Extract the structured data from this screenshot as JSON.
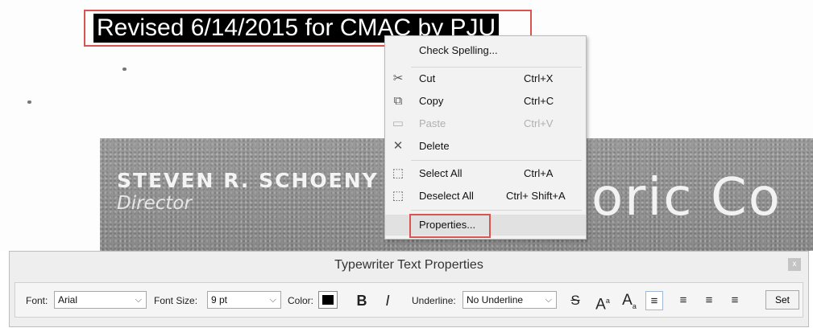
{
  "document": {
    "header_text": "Revised 6/14/2015 for CMAC by PJU",
    "scan": {
      "name": "STEVEN R. SCHOENY",
      "title": "Director",
      "big_text_1": "oric",
      "big_text_2": "Co"
    }
  },
  "context_menu": {
    "items": [
      {
        "label": "Check Spelling...",
        "shortcut": "",
        "icon": "",
        "disabled": false
      },
      {
        "label": "Cut",
        "shortcut": "Ctrl+X",
        "icon": "scissors-icon",
        "disabled": false
      },
      {
        "label": "Copy",
        "shortcut": "Ctrl+C",
        "icon": "copy-icon",
        "disabled": false
      },
      {
        "label": "Paste",
        "shortcut": "Ctrl+V",
        "icon": "paste-icon",
        "disabled": true
      },
      {
        "label": "Delete",
        "shortcut": "",
        "icon": "delete-icon",
        "disabled": false
      },
      {
        "label": "Select All",
        "shortcut": "Ctrl+A",
        "icon": "select-all-icon",
        "disabled": false
      },
      {
        "label": "Deselect All",
        "shortcut": "Ctrl+ Shift+A",
        "icon": "deselect-all-icon",
        "disabled": false
      },
      {
        "label": "Properties...",
        "shortcut": "",
        "icon": "",
        "disabled": false
      }
    ]
  },
  "properties_bar": {
    "title": "Typewriter Text Properties",
    "close": "x",
    "font_label": "Font:",
    "font_value": "Arial",
    "size_label": "Font Size:",
    "size_value": "9 pt",
    "color_label": "Color:",
    "color_value": "#000000",
    "bold": "B",
    "italic": "I",
    "underline_label": "Underline:",
    "underline_value": "No Underline",
    "strike": "S",
    "superscript": "A",
    "subscript": "A",
    "set_label": "Set"
  }
}
